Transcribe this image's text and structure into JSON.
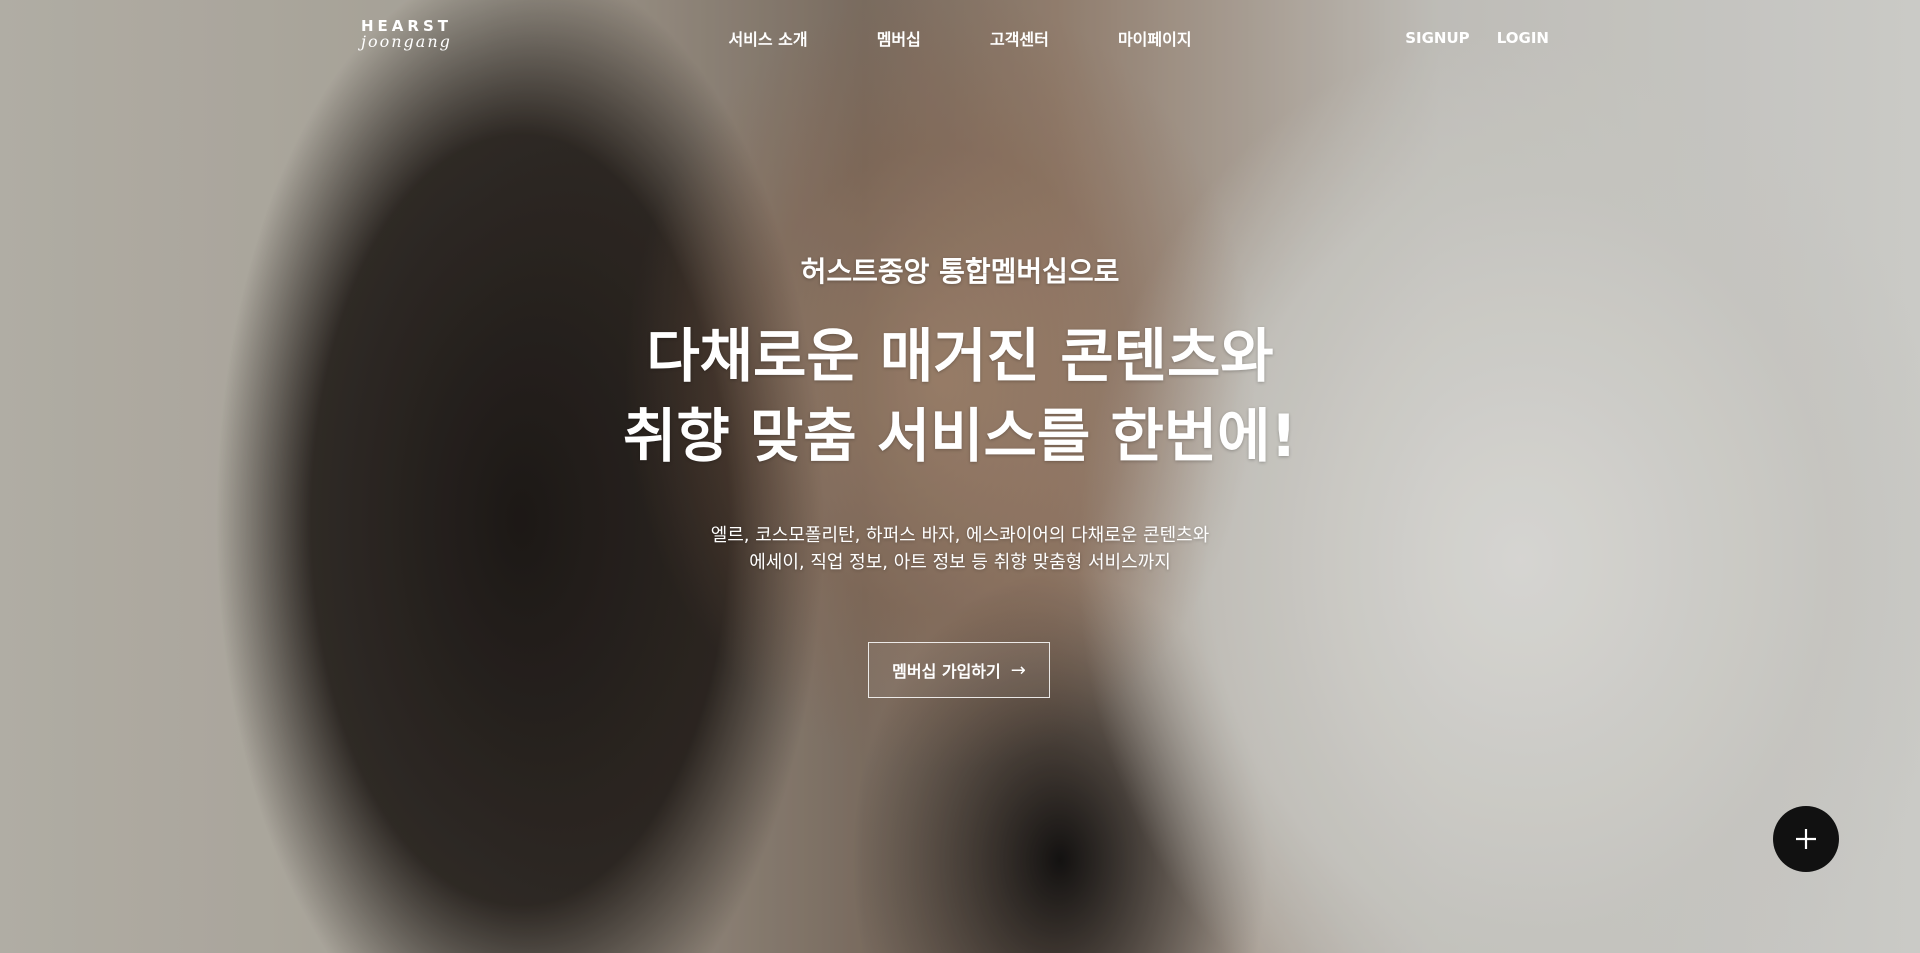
{
  "nav": {
    "logo": {
      "line1": "HEARST",
      "line2": "joongang"
    },
    "menu": [
      "서비스 소개",
      "멤버십",
      "고객센터",
      "마이페이지"
    ],
    "auth": {
      "signup": "SIGNUP",
      "login": "LOGIN"
    }
  },
  "hero": {
    "subtitle": "허스트중앙 통합멤버십으로",
    "headline_line1": "다채로운 매거진 콘텐츠와",
    "headline_line2": "취향 맞춤 서비스를 한번에!",
    "desc_line1": "엘르, 코스모폴리탄, 하퍼스 바자, 에스콰이어의 다채로운 콘텐츠와",
    "desc_line2": "에세이, 직업 정보, 아트 정보 등 취향 맞춤형 서비스까지",
    "cta_label": "멤버십 가입하기",
    "cta_icon": "arrow-right-icon"
  },
  "fab": {
    "icon": "plus-icon"
  },
  "colors": {
    "text": "#ffffff",
    "fab_bg": "#111111"
  }
}
